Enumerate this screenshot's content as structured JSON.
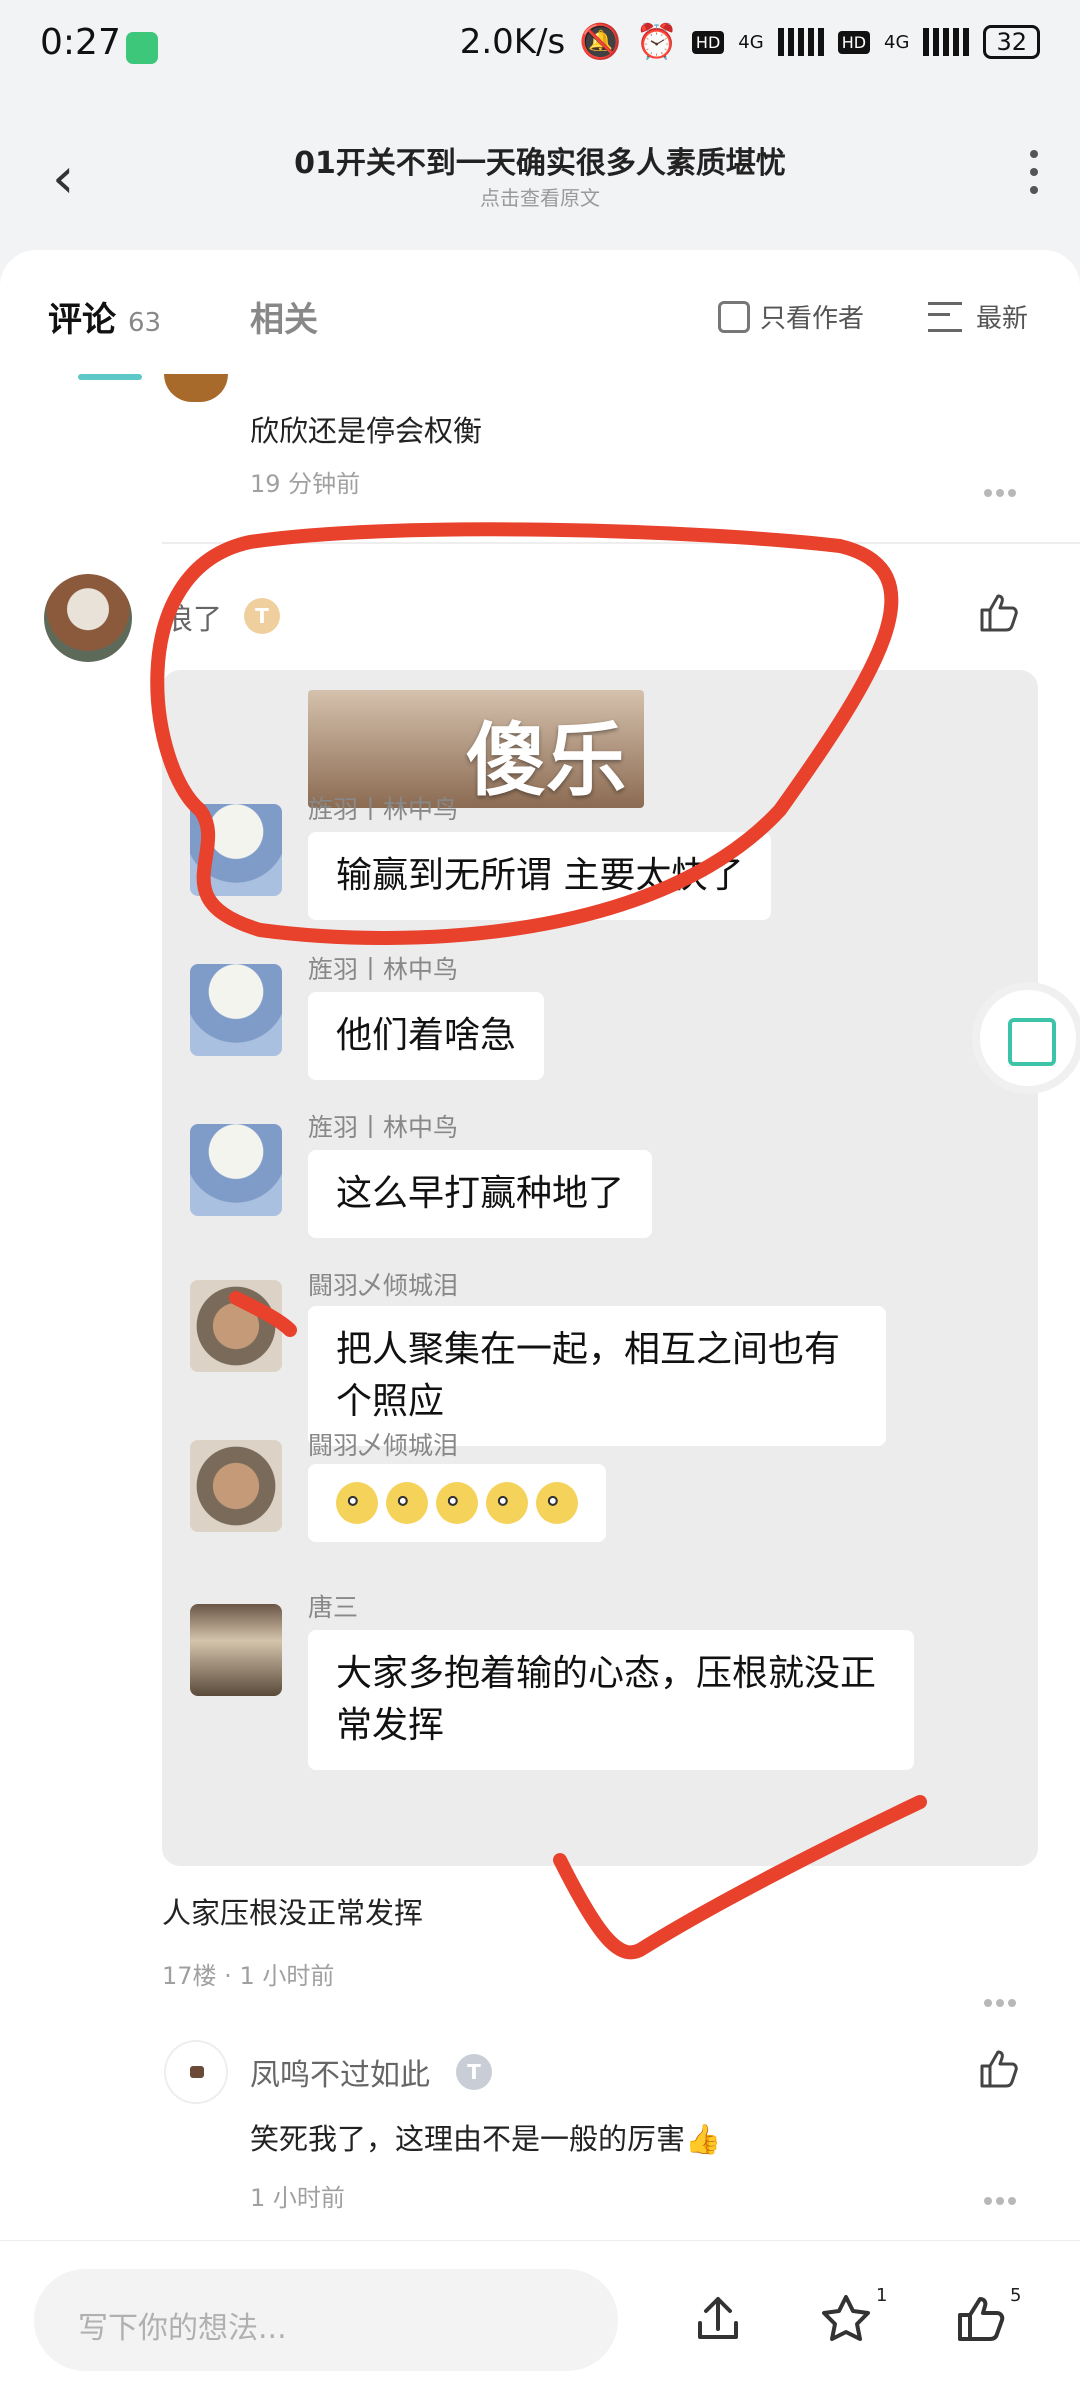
{
  "status_bar": {
    "time": "0:27",
    "net_speed": "2.0K/s",
    "signal_1": "4G",
    "signal_2": "4G",
    "battery": "32"
  },
  "header": {
    "title": "01开关不到一天确实很多人素质堪忧",
    "subtitle": "点击查看原文"
  },
  "tabs": {
    "comments_label": "评论",
    "comments_count": "63",
    "related_label": "相关",
    "author_only_label": "只看作者",
    "sort_label": "最新"
  },
  "previous_comment": {
    "text": "欣欣还是停会权衡",
    "time": "19 分钟前"
  },
  "comment": {
    "username": "浪了",
    "level": "T",
    "screenshot": {
      "sticker_text": "傻乐",
      "messages": [
        {
          "name": "旌羽丨林中鸟",
          "text": "输赢到无所谓 主要太快了"
        },
        {
          "name": "旌羽丨林中鸟",
          "text": "他们着啥急"
        },
        {
          "name": "旌羽丨林中鸟",
          "text": "这么早打赢种地了"
        },
        {
          "name": "闘羽乄倾城泪",
          "text": "把人聚集在一起，相互之间也有个照应"
        },
        {
          "name": "闘羽乄倾城泪",
          "text": ""
        },
        {
          "name": "唐三",
          "text": "大家多抱着输的心态，压根就没正常发挥"
        }
      ]
    },
    "caption": "人家压根没正常发挥",
    "floor": "17楼",
    "time": "1 小时前"
  },
  "reply": {
    "username": "凤鸣不过如此",
    "level": "T",
    "text": "笑死我了，这理由不是一般的厉害👍",
    "time": "1 小时前"
  },
  "bottom_bar": {
    "input_placeholder": "写下你的想法...",
    "favorite_count": "1",
    "like_count": "5"
  },
  "colors": {
    "accent": "#5cc8c8",
    "annotation_red": "#e8412c"
  }
}
